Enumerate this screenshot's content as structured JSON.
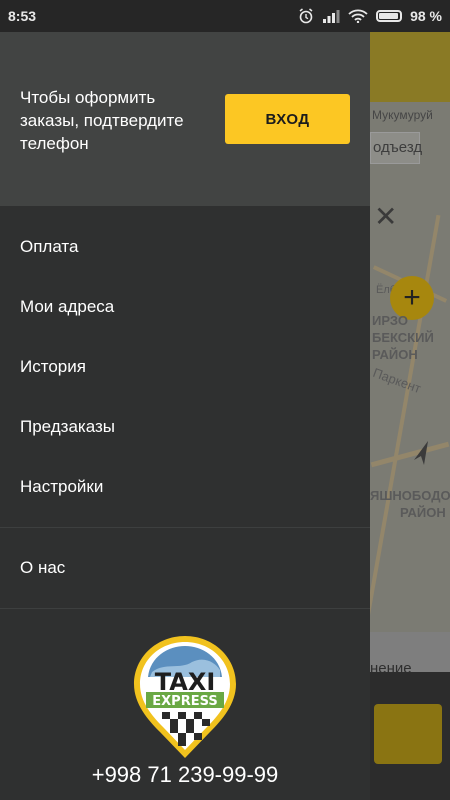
{
  "statusbar": {
    "time": "8:53",
    "battery": "98 %"
  },
  "drawer": {
    "header_text": "Чтобы оформить заказы, подтвердите телефон",
    "login_label": "ВХОД",
    "menu": [
      {
        "label": "Оплата"
      },
      {
        "label": "Мои адреса"
      },
      {
        "label": "История"
      },
      {
        "label": "Предзаказы"
      },
      {
        "label": "Настройки"
      }
    ],
    "about_label": "О нас",
    "logo": {
      "word1": "TAXI",
      "word2": "EXPRESS"
    },
    "phone": "+998 71 239-99-99"
  },
  "map": {
    "street_partial": "Мукумуруй",
    "entrance_partial": "одъезд",
    "district1": [
      "ИРЗО",
      "БЕКСКИЙ",
      "РАЙОН"
    ],
    "district2": [
      "ЯШНОБОДО",
      "РАЙОН"
    ],
    "road_label": "Паркент",
    "road_label2": "Ёлбули",
    "bottom_partial": "нение"
  },
  "colors": {
    "accent": "#fcc723",
    "drawer_bg": "#2f3030",
    "header_bg": "#424443"
  }
}
